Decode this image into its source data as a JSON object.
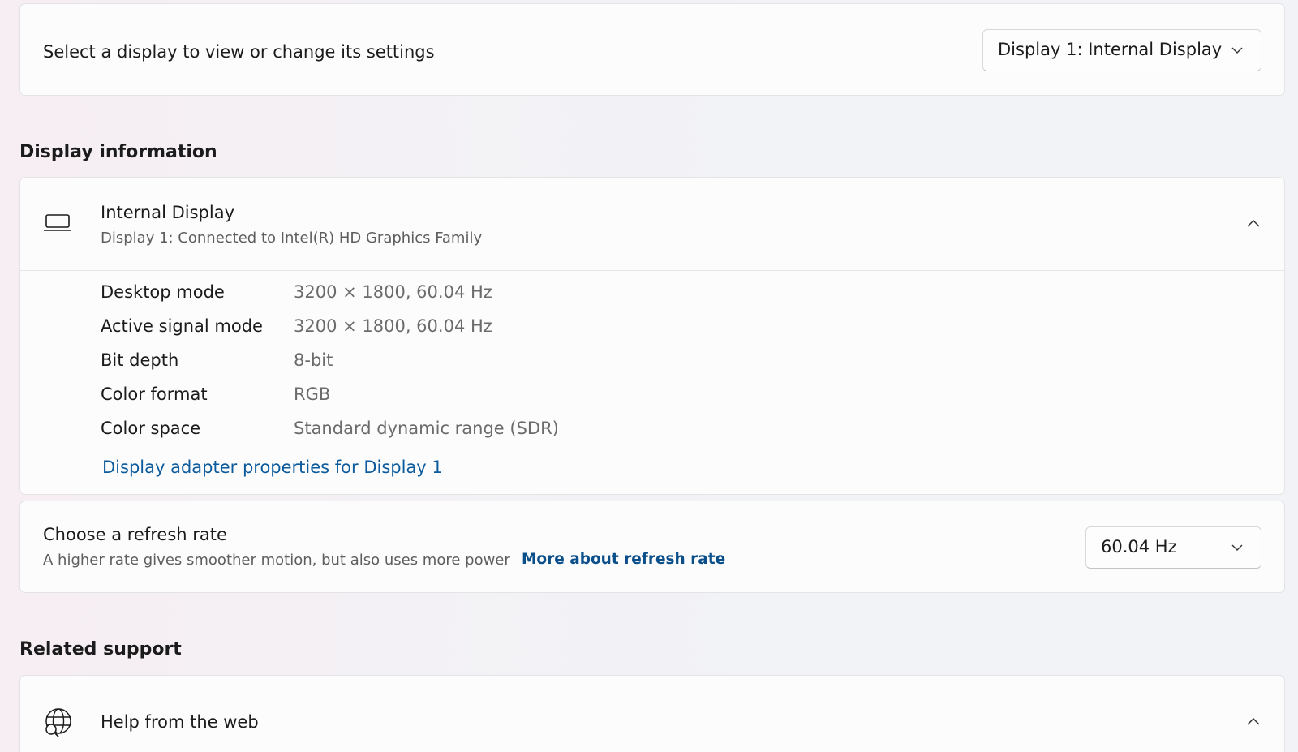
{
  "display_select": {
    "label": "Select a display to view or change its settings",
    "dropdown_value": "Display 1: Internal Display"
  },
  "display_information": {
    "heading": "Display information",
    "title": "Internal Display",
    "subtitle": "Display 1: Connected to Intel(R) HD Graphics Family",
    "properties": [
      {
        "label": "Desktop mode",
        "value": "3200 × 1800, 60.04 Hz"
      },
      {
        "label": "Active signal mode",
        "value": "3200 × 1800, 60.04 Hz"
      },
      {
        "label": "Bit depth",
        "value": "8-bit"
      },
      {
        "label": "Color format",
        "value": "RGB"
      },
      {
        "label": "Color space",
        "value": "Standard dynamic range (SDR)"
      }
    ],
    "adapter_link": "Display adapter properties for Display 1"
  },
  "refresh_rate": {
    "title": "Choose a refresh rate",
    "description": "A higher rate gives smoother motion, but also uses more power",
    "link": "More about refresh rate",
    "dropdown_value": "60.04 Hz"
  },
  "related_support": {
    "heading": "Related support",
    "help_title": "Help from the web"
  },
  "icons": {
    "laptop": "laptop-icon",
    "globe": "globe-search-icon",
    "chevron_down": "chevron-down-icon",
    "chevron_up": "chevron-up-icon"
  },
  "colors": {
    "link": "#0b5a9c",
    "link_bold": "#0b4f8a",
    "card_background": "#fcfcfd",
    "secondary_text": "#5e5e5e"
  }
}
